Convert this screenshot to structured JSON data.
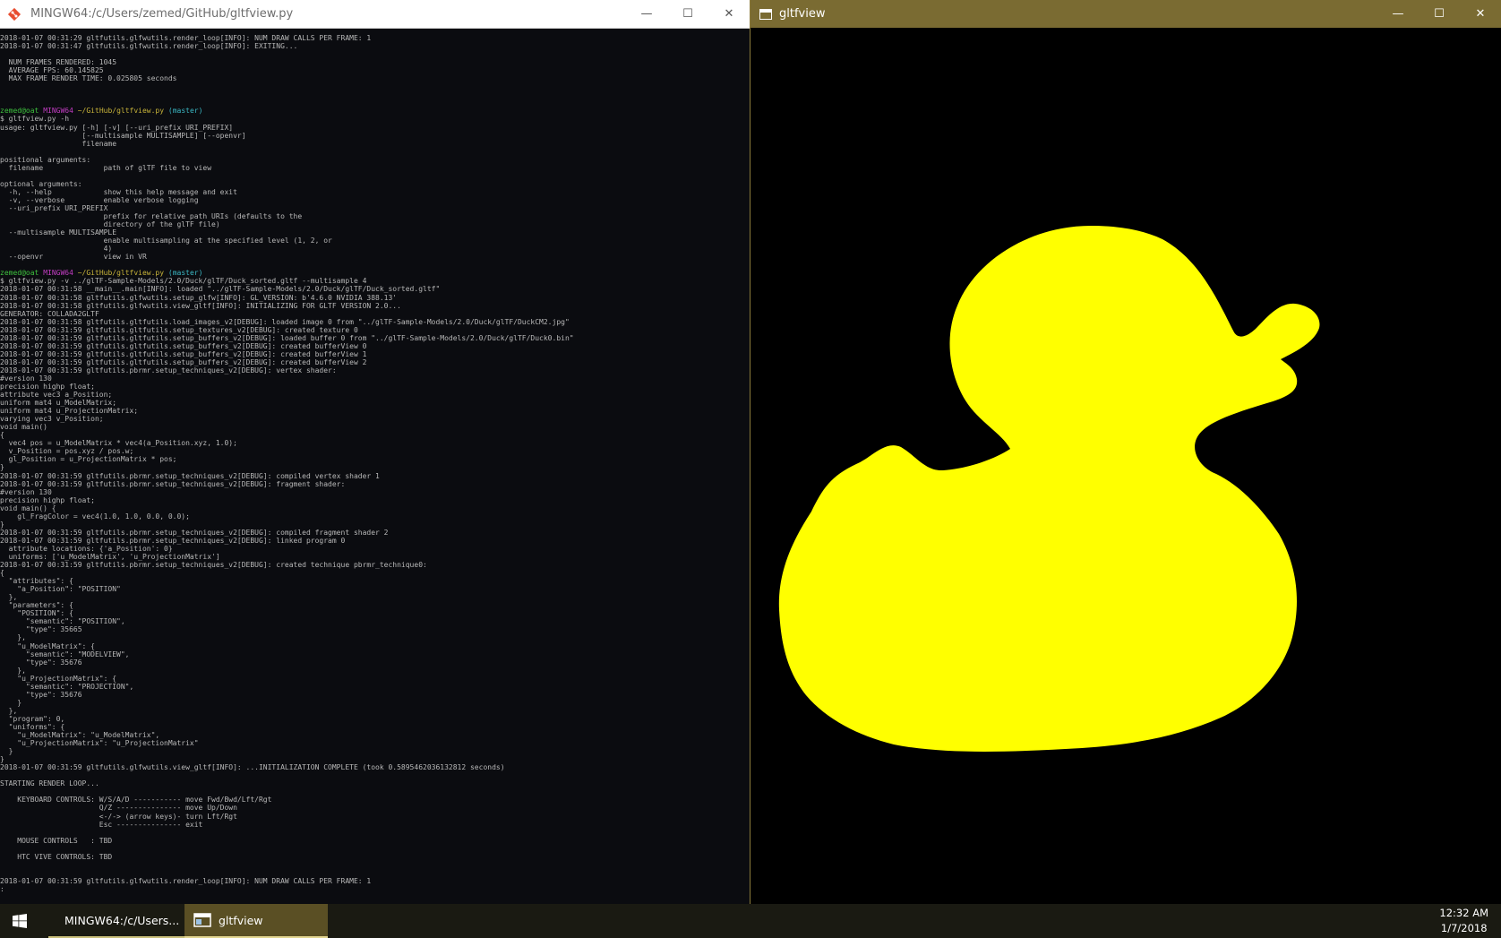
{
  "terminal": {
    "title": "MINGW64:/c/Users/zemed/GitHub/gltfview.py",
    "controls": {
      "minimize": "—",
      "maximize": "☐",
      "close": "✕"
    },
    "lines": [
      "2018-01-07 00:31:29 gltfutils.glfwutils.render_loop[INFO]: NUM DRAW CALLS PER FRAME: 1",
      "2018-01-07 00:31:47 gltfutils.glfwutils.render_loop[INFO]: EXITING...",
      "",
      "  NUM FRAMES RENDERED: 1045",
      "  AVERAGE FPS: 60.145825",
      "  MAX FRAME RENDER TIME: 0.025805 seconds",
      "",
      "",
      "",
      "PROMPT1",
      "$ gltfview.py -h",
      "usage: gltfview.py [-h] [-v] [--uri_prefix URI_PREFIX]",
      "                   [--multisample MULTISAMPLE] [--openvr]",
      "                   filename",
      "",
      "positional arguments:",
      "  filename              path of glTF file to view",
      "",
      "optional arguments:",
      "  -h, --help            show this help message and exit",
      "  -v, --verbose         enable verbose logging",
      "  --uri_prefix URI_PREFIX",
      "                        prefix for relative path URIs (defaults to the",
      "                        directory of the glTF file)",
      "  --multisample MULTISAMPLE",
      "                        enable multisampling at the specified level (1, 2, or",
      "                        4)",
      "  --openvr              view in VR",
      "",
      "PROMPT2",
      "$ gltfview.py -v ../glTF-Sample-Models/2.0/Duck/glTF/Duck_sorted.gltf --multisample 4",
      "2018-01-07 00:31:58 __main__.main[INFO]: loaded \"../glTF-Sample-Models/2.0/Duck/glTF/Duck_sorted.gltf\"",
      "2018-01-07 00:31:58 gltfutils.glfwutils.setup_glfw[INFO]: GL_VERSION: b'4.6.0 NVIDIA 388.13'",
      "2018-01-07 00:31:58 gltfutils.glfwutils.view_gltf[INFO]: INITIALIZING FOR GLTF VERSION 2.0...",
      "GENERATOR: COLLADA2GLTF",
      "2018-01-07 00:31:58 gltfutils.gltfutils.load_images_v2[DEBUG]: loaded image 0 from \"../glTF-Sample-Models/2.0/Duck/glTF/DuckCM2.jpg\"",
      "2018-01-07 00:31:59 gltfutils.gltfutils.setup_textures_v2[DEBUG]: created texture 0",
      "2018-01-07 00:31:59 gltfutils.gltfutils.setup_buffers_v2[DEBUG]: loaded buffer 0 from \"../glTF-Sample-Models/2.0/Duck/glTF/Duck0.bin\"",
      "2018-01-07 00:31:59 gltfutils.gltfutils.setup_buffers_v2[DEBUG]: created bufferView 0",
      "2018-01-07 00:31:59 gltfutils.gltfutils.setup_buffers_v2[DEBUG]: created bufferView 1",
      "2018-01-07 00:31:59 gltfutils.gltfutils.setup_buffers_v2[DEBUG]: created bufferView 2",
      "2018-01-07 00:31:59 gltfutils.pbrmr.setup_techniques_v2[DEBUG]: vertex shader:",
      "#version 130",
      "precision highp float;",
      "attribute vec3 a_Position;",
      "uniform mat4 u_ModelMatrix;",
      "uniform mat4 u_ProjectionMatrix;",
      "varying vec3 v_Position;",
      "void main()",
      "{",
      "  vec4 pos = u_ModelMatrix * vec4(a_Position.xyz, 1.0);",
      "  v_Position = pos.xyz / pos.w;",
      "  gl_Position = u_ProjectionMatrix * pos;",
      "}",
      "2018-01-07 00:31:59 gltfutils.pbrmr.setup_techniques_v2[DEBUG]: compiled vertex shader 1",
      "2018-01-07 00:31:59 gltfutils.pbrmr.setup_techniques_v2[DEBUG]: fragment shader:",
      "#version 130",
      "precision highp float;",
      "void main() {",
      "    gl_FragColor = vec4(1.0, 1.0, 0.0, 0.0);",
      "}",
      "2018-01-07 00:31:59 gltfutils.pbrmr.setup_techniques_v2[DEBUG]: compiled fragment shader 2",
      "2018-01-07 00:31:59 gltfutils.pbrmr.setup_techniques_v2[DEBUG]: linked program 0",
      "  attribute locations: {'a_Position': 0}",
      "  uniforms: ['u_ModelMatrix', 'u_ProjectionMatrix']",
      "2018-01-07 00:31:59 gltfutils.pbrmr.setup_techniques_v2[DEBUG]: created technique pbrmr_technique0:",
      "{",
      "  \"attributes\": {",
      "    \"a_Position\": \"POSITION\"",
      "  },",
      "  \"parameters\": {",
      "    \"POSITION\": {",
      "      \"semantic\": \"POSITION\",",
      "      \"type\": 35665",
      "    },",
      "    \"u_ModelMatrix\": {",
      "      \"semantic\": \"MODELVIEW\",",
      "      \"type\": 35676",
      "    },",
      "    \"u_ProjectionMatrix\": {",
      "      \"semantic\": \"PROJECTION\",",
      "      \"type\": 35676",
      "    }",
      "  },",
      "  \"program\": 0,",
      "  \"uniforms\": {",
      "    \"u_ModelMatrix\": \"u_ModelMatrix\",",
      "    \"u_ProjectionMatrix\": \"u_ProjectionMatrix\"",
      "  }",
      "}",
      "2018-01-07 00:31:59 gltfutils.glfwutils.view_gltf[INFO]: ...INITIALIZATION COMPLETE (took 0.5895462036132812 seconds)",
      "",
      "STARTING RENDER LOOP...",
      "",
      "    KEYBOARD CONTROLS: W/S/A/D ----------- move Fwd/Bwd/Lft/Rgt",
      "                       Q/Z --------------- move Up/Down",
      "                       <-/-> (arrow keys)- turn Lft/Rgt",
      "                       Esc --------------- exit",
      "",
      "    MOUSE CONTROLS   : TBD",
      "",
      "    HTC VIVE CONTROLS: TBD",
      "",
      "",
      "2018-01-07 00:31:59 gltfutils.glfwutils.render_loop[INFO]: NUM DRAW CALLS PER FRAME: 1",
      ":"
    ],
    "prompt": {
      "user": "zemed@oat",
      "env": "MINGW64",
      "path": "~/GitHub/gltfview.py",
      "branch": "(master)"
    }
  },
  "render_window": {
    "title": "gltfview",
    "controls": {
      "minimize": "—",
      "maximize": "☐",
      "close": "✕"
    },
    "model_color": "#ffff00",
    "background": "#000000"
  },
  "taskbar": {
    "start_icon": "windows-logo-icon",
    "items": [
      {
        "label": "MINGW64:/c/Users...",
        "icon": "git-bash-icon"
      },
      {
        "label": "gltfview",
        "icon": "window-icon"
      }
    ],
    "clock": {
      "time": "12:32 AM",
      "date": "1/7/2018"
    }
  }
}
